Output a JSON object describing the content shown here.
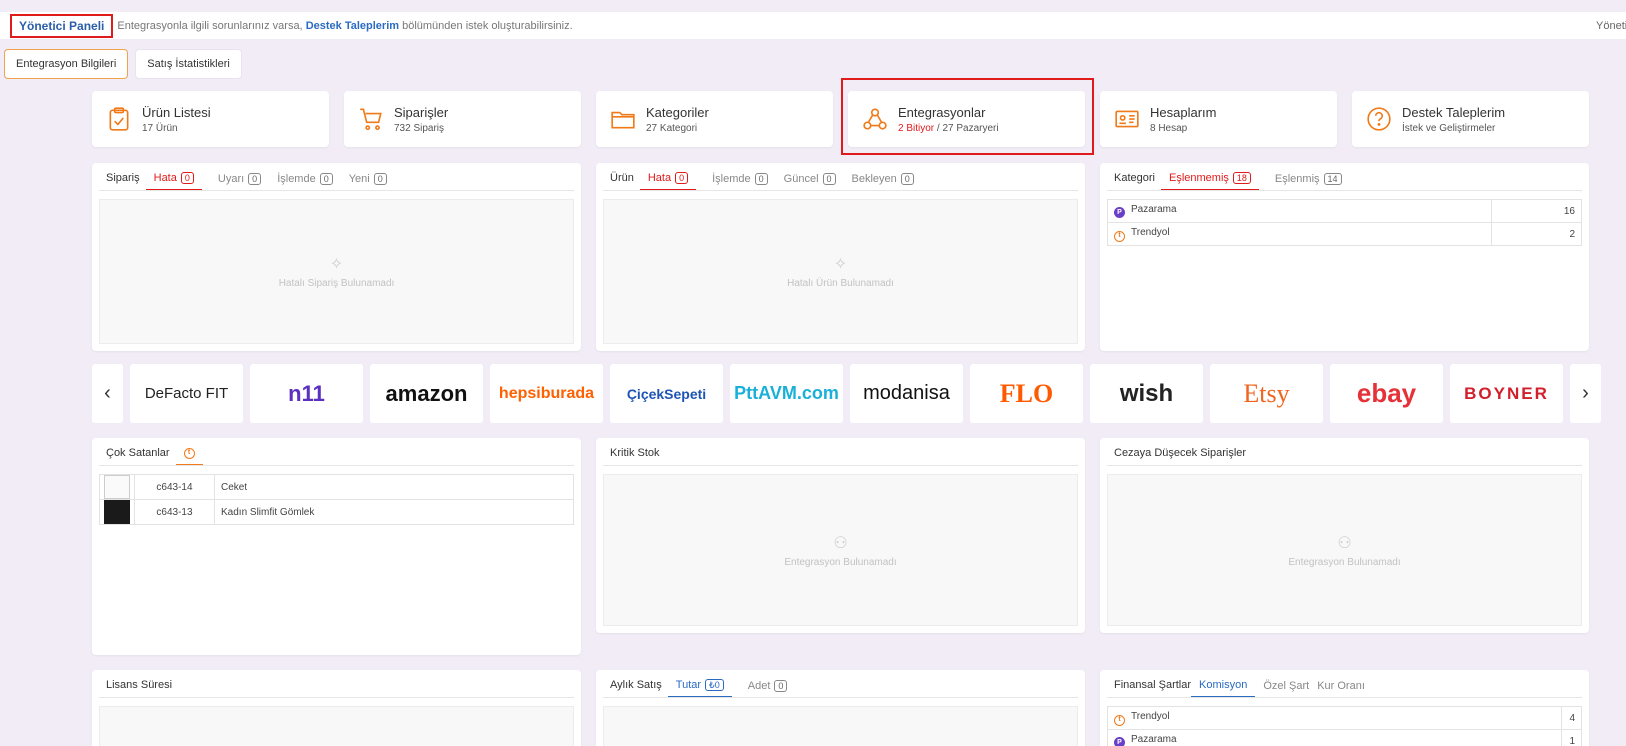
{
  "header": {
    "title": "Yönetici Paneli",
    "message_prefix": "Entegrasyonla ilgili sorunlarınız varsa,",
    "message_link": "Destek Taleplerim",
    "message_suffix": "bölümünden istek oluşturabilirsiniz.",
    "user_label": "Yönetici"
  },
  "tabs": [
    "Entegrasyon Bilgileri",
    "Satış İstatistikleri"
  ],
  "stats": [
    {
      "title": "Ürün Listesi",
      "sub": "17 Ürün",
      "icon": "clipboard-check-icon"
    },
    {
      "title": "Siparişler",
      "sub": "732 Sipariş",
      "icon": "cart-icon"
    },
    {
      "title": "Kategoriler",
      "sub": "27 Kategori",
      "icon": "folder-icon"
    },
    {
      "title": "Entegrasyonlar",
      "sub_red": "2 Bitiyor",
      "sub_rest": " / 27 Pazaryeri",
      "icon": "webhook-icon"
    },
    {
      "title": "Hesaplarım",
      "sub": "8 Hesap",
      "icon": "id-card-icon"
    },
    {
      "title": "Destek Taleplerim",
      "sub": "İstek ve Geliştirmeler",
      "icon": "question-circle-icon"
    }
  ],
  "siparis_panel": {
    "label": "Sipariş",
    "tabs": [
      {
        "name": "Hata",
        "count": "0"
      },
      {
        "name": "Uyarı",
        "count": "0"
      },
      {
        "name": "İşlemde",
        "count": "0"
      },
      {
        "name": "Yeni",
        "count": "0"
      }
    ],
    "empty": "Hatalı Sipariş Bulunamadı"
  },
  "urun_panel": {
    "label": "Ürün",
    "tabs": [
      {
        "name": "Hata",
        "count": "0"
      },
      {
        "name": "İşlemde",
        "count": "0"
      },
      {
        "name": "Güncel",
        "count": "0"
      },
      {
        "name": "Bekleyen",
        "count": "0"
      }
    ],
    "empty": "Hatalı Ürün Bulunamadı"
  },
  "kategori_panel": {
    "label": "Kategori",
    "tabs": [
      {
        "name": "Eşlenmemiş",
        "count": "18"
      },
      {
        "name": "Eşlenmiş",
        "count": "14"
      }
    ],
    "rows": [
      {
        "name": "Pazarama",
        "value": "16"
      },
      {
        "name": "Trendyol",
        "value": "2"
      }
    ]
  },
  "brands": [
    "DeFacto FIT",
    "n11",
    "amazon",
    "hepsiburada",
    "ÇiçekSepeti",
    "PttAVM.com",
    "modanisa",
    "FLO",
    "wish",
    "Etsy",
    "ebay",
    "BOYNER"
  ],
  "cok_satanlar": {
    "label": "Çok Satanlar",
    "rows": [
      {
        "code": "c643-14",
        "name": "Ceket"
      },
      {
        "code": "c643-13",
        "name": "Kadın Slimfit Gömlek"
      }
    ]
  },
  "kritik_stok": {
    "label": "Kritik Stok",
    "empty": "Entegrasyon Bulunamadı"
  },
  "cezaya": {
    "label": "Cezaya Düşecek Siparişler",
    "empty": "Entegrasyon Bulunamadı"
  },
  "lisans": {
    "label": "Lisans Süresi"
  },
  "aylik": {
    "label": "Aylık Satış",
    "tabs": [
      {
        "name": "Tutar",
        "count": "₺0"
      },
      {
        "name": "Adet",
        "count": "0"
      }
    ]
  },
  "finansal": {
    "label": "Finansal Şartlar",
    "tabs": [
      "Komisyon",
      "Özel Şart",
      "Kur Oranı"
    ],
    "rows": [
      {
        "name": "Trendyol",
        "value": "4"
      },
      {
        "name": "Pazarama",
        "value": "1"
      }
    ]
  }
}
